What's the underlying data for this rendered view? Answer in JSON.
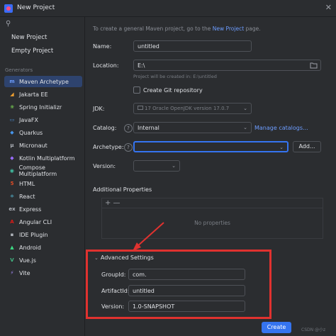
{
  "window": {
    "title": "New Project",
    "close_glyph": "✕"
  },
  "sidebar": {
    "search_icon_glyph": "⚲",
    "top_items": [
      "New Project",
      "Empty Project"
    ],
    "generators_label": "Generators",
    "generators": [
      {
        "label": "Maven Archetype",
        "icon": "m",
        "color": "#6d9dff"
      },
      {
        "label": "Jakarta EE",
        "icon": "◢",
        "color": "#f0a030"
      },
      {
        "label": "Spring Initializr",
        "icon": "❀",
        "color": "#6ab04c"
      },
      {
        "label": "JavaFX",
        "icon": "▭",
        "color": "#4a90d9"
      },
      {
        "label": "Quarkus",
        "icon": "◆",
        "color": "#4695eb"
      },
      {
        "label": "Micronaut",
        "icon": "μ",
        "color": "#b0b4bb"
      },
      {
        "label": "Kotlin Multiplatform",
        "icon": "◆",
        "color": "#9a6cff"
      },
      {
        "label": "Compose Multiplatform",
        "icon": "◉",
        "color": "#42c6a8"
      },
      {
        "label": "HTML",
        "icon": "5",
        "color": "#e44d26"
      },
      {
        "label": "React",
        "icon": "⚛",
        "color": "#61dafb"
      },
      {
        "label": "Express",
        "icon": "ex",
        "color": "#b0b4bb"
      },
      {
        "label": "Angular CLI",
        "icon": "A",
        "color": "#dd1b16"
      },
      {
        "label": "IDE Plugin",
        "icon": "▪",
        "color": "#b0b4bb"
      },
      {
        "label": "Android",
        "icon": "▲",
        "color": "#3ddc84"
      },
      {
        "label": "Vue.js",
        "icon": "V",
        "color": "#42b883"
      },
      {
        "label": "Vite",
        "icon": "⚡",
        "color": "#a78bfa"
      }
    ]
  },
  "main": {
    "intro_text": "To create a general Maven project, go to the ",
    "intro_link": "New Project",
    "intro_suffix": " page.",
    "name_label": "Name:",
    "name_value": "untitled",
    "location_label": "Location:",
    "location_value": "E:\\",
    "location_hint": "Project will be created in: E:\\untitled",
    "git_label": "Create Git repository",
    "jdk_label": "JDK:",
    "jdk_value": "17 Oracle OpenJDK version 17.0.7",
    "catalog_label": "Catalog:",
    "catalog_value": "Internal",
    "manage_catalogs": "Manage catalogs...",
    "archetype_label": "Archetype:",
    "archetype_value": "",
    "add_button": "Add...",
    "version_label": "Version:",
    "additional_properties": "Additional Properties",
    "props_toolbar": "+ —",
    "no_properties": "No properties",
    "advanced_settings": "Advanced Settings",
    "groupid_label": "GroupId:",
    "groupid_value": "com.",
    "artifactid_label": "ArtifactId:",
    "artifactid_value": "untitled",
    "adv_version_label": "Version:",
    "adv_version_value": "1.0-SNAPSHOT",
    "create_button": "Create",
    "watermark": "CSDN @小z"
  },
  "colors": {
    "accent": "#3574f0",
    "highlight_border": "#e0322f",
    "link": "#6d9dff"
  }
}
